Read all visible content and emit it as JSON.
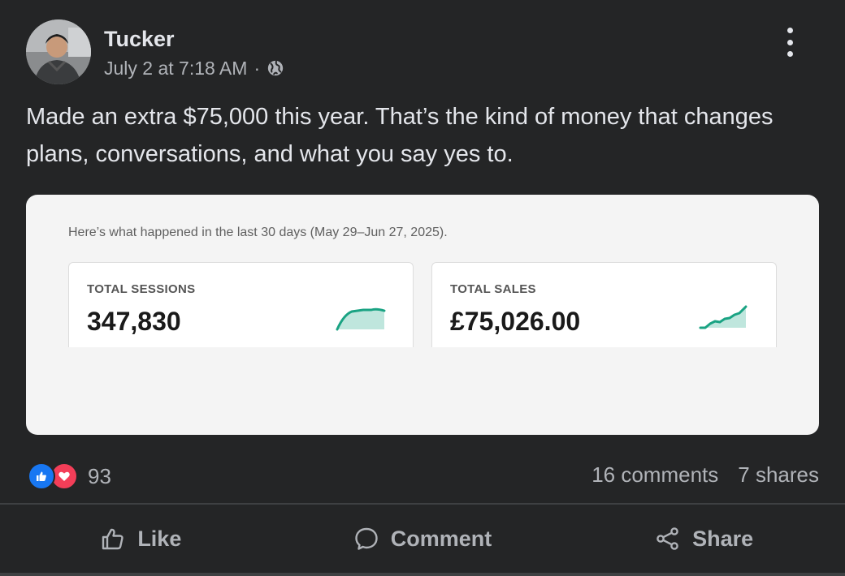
{
  "post": {
    "author": "Tucker",
    "timestamp": "July 2 at 7:18 AM",
    "separator": "·",
    "audience_icon": "globe-icon",
    "text": "Made an extra $75,000 this year. That’s the kind of money that changes plans, conversations, and what you say yes to."
  },
  "card": {
    "caption": "Here’s what happened in the last 30 days (May 29–Jun 27, 2025).",
    "stats": [
      {
        "label": "TOTAL SESSIONS",
        "value": "347,830",
        "trend_icon": "sparkline-area-icon"
      },
      {
        "label": "TOTAL SALES",
        "value": "£75,026.00",
        "trend_icon": "sparkline-area-icon"
      }
    ],
    "accent_color": "#1aa383",
    "fill_color": "#bfe6dd"
  },
  "engagement": {
    "reaction_count": "93",
    "reaction_icons": [
      "like-icon",
      "love-icon"
    ],
    "comments": "16 comments",
    "shares": "7 shares"
  },
  "actions": {
    "like": "Like",
    "comment": "Comment",
    "share": "Share"
  },
  "colors": {
    "background": "#242526",
    "like_blue": "#1877f2",
    "love_red": "#f33e58"
  }
}
